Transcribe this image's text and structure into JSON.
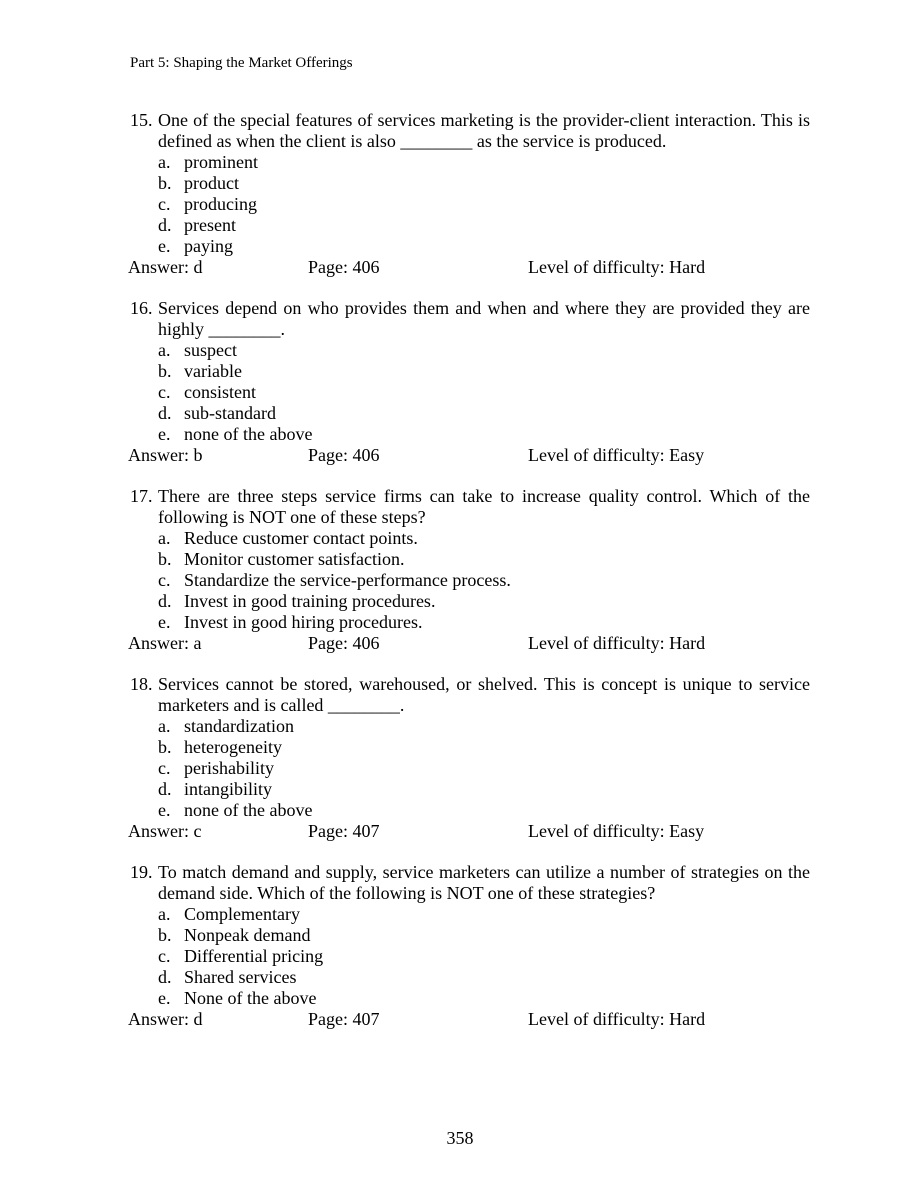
{
  "header": "Part 5: Shaping the Market Offerings",
  "page_number": "358",
  "answer_label": "Answer: ",
  "page_label": "Page: ",
  "difficulty_label": "Level of difficulty: ",
  "questions": [
    {
      "number": "15.",
      "text": "One of the special features of services marketing is the provider-client interaction. This is defined as when the client is also ________ as the service is produced.",
      "options": [
        {
          "letter": "a.",
          "text": "prominent"
        },
        {
          "letter": "b.",
          "text": "product"
        },
        {
          "letter": "c.",
          "text": "producing"
        },
        {
          "letter": "d.",
          "text": "present"
        },
        {
          "letter": "e.",
          "text": "paying"
        }
      ],
      "answer": "d",
      "page": "406",
      "difficulty": "Hard"
    },
    {
      "number": "16.",
      "text": "Services depend on who provides them and when and where they are provided they are highly ________.",
      "options": [
        {
          "letter": "a.",
          "text": "suspect"
        },
        {
          "letter": "b.",
          "text": "variable"
        },
        {
          "letter": "c.",
          "text": " consistent"
        },
        {
          "letter": "d.",
          "text": " sub-standard"
        },
        {
          "letter": "e.",
          "text": " none of the above"
        }
      ],
      "answer": "b",
      "page": "406",
      "difficulty": "Easy"
    },
    {
      "number": "17.",
      "text": "There are three steps service firms can take to increase quality control. Which of the following is NOT one of these steps?",
      "options": [
        {
          "letter": "a.",
          "text": " Reduce customer contact points."
        },
        {
          "letter": "b.",
          "text": " Monitor customer satisfaction."
        },
        {
          "letter": "c.",
          "text": " Standardize the service-performance process."
        },
        {
          "letter": "d.",
          "text": " Invest in good training procedures."
        },
        {
          "letter": "e.",
          "text": " Invest in good hiring procedures."
        }
      ],
      "answer": "a",
      "page": "406",
      "difficulty": "Hard"
    },
    {
      "number": "18.",
      "text": "Services cannot be stored, warehoused, or shelved. This is concept is unique to service marketers and is called ________.",
      "options": [
        {
          "letter": "a.",
          "text": " standardization"
        },
        {
          "letter": "b.",
          "text": " heterogeneity"
        },
        {
          "letter": "c.",
          "text": " perishability"
        },
        {
          "letter": "d.",
          "text": " intangibility"
        },
        {
          "letter": "e.",
          "text": " none of the above"
        }
      ],
      "answer": "c",
      "page": "407",
      "difficulty": "Easy"
    },
    {
      "number": "19.",
      "text": "To match demand and supply, service marketers can utilize a number of strategies on the demand side. Which of the following is NOT one of these strategies?",
      "options": [
        {
          "letter": "a.",
          "text": " Complementary"
        },
        {
          "letter": "b.",
          "text": " Nonpeak demand"
        },
        {
          "letter": "c.",
          "text": " Differential pricing"
        },
        {
          "letter": "d.",
          "text": " Shared services"
        },
        {
          "letter": "e.",
          "text": " None of the above"
        }
      ],
      "answer": "d",
      "page": "407",
      "difficulty": "Hard"
    }
  ]
}
